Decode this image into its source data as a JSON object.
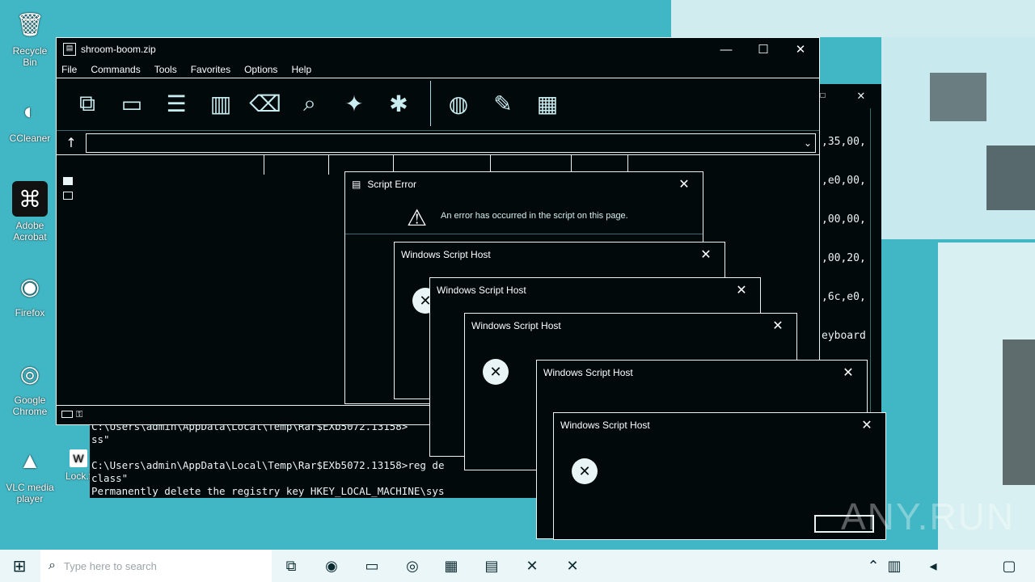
{
  "desktop": {
    "icons": [
      {
        "label": "Recycle Bin",
        "icon": "recycle-bin-icon"
      },
      {
        "label": "CCleaner",
        "icon": "ccleaner-icon"
      },
      {
        "label": "Adobe Acrobat",
        "icon": "acrobat-icon"
      },
      {
        "label": "Firefox",
        "icon": "firefox-icon"
      },
      {
        "label": "Google Chrome",
        "icon": "chrome-icon"
      },
      {
        "label": "VLC media player",
        "icon": "vlc-icon"
      },
      {
        "label": "Lock.f",
        "icon": "word-doc-icon"
      }
    ]
  },
  "rar": {
    "title": "shroom-boom.zip",
    "menu": [
      "File",
      "Commands",
      "Tools",
      "Favorites",
      "Options",
      "Help"
    ]
  },
  "regwin": {
    "lines": [
      ",35,00,",
      ",e0,00,",
      ",00,00,",
      ",00,20,",
      ",6c,e0,",
      "eyboard"
    ]
  },
  "console": {
    "lines": [
      "C:\\Users\\admin\\AppData\\Local\\Temp\\Rar$EXb5072.13158>",
      "ss\"",
      "",
      "C:\\Users\\admin\\AppData\\Local\\Temp\\Rar$EXb5072.13158>reg de",
      "class\"",
      "Permanently delete the registry key HKEY_LOCAL_MACHINE\\sys"
    ]
  },
  "script_error": {
    "title": "Script Error",
    "message": "An error has occurred in the script on this page."
  },
  "wsh": {
    "title": "Windows Script Host"
  },
  "taskbar": {
    "search_placeholder": "Type here to search"
  },
  "watermark": "ANY.RUN"
}
